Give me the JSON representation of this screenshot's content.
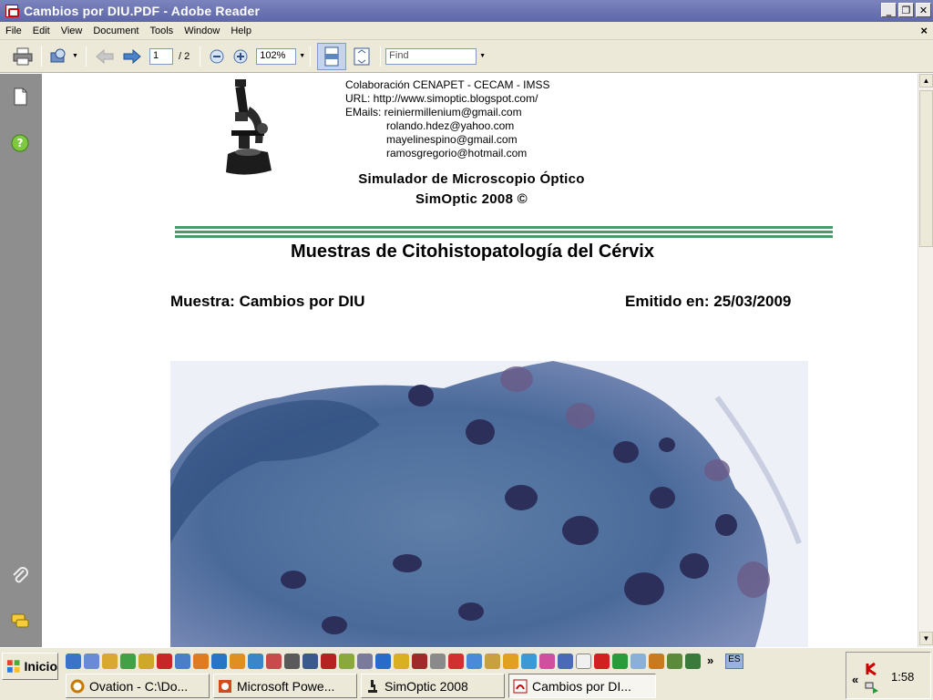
{
  "window": {
    "title": "Cambios por DIU.PDF - Adobe Reader",
    "buttons": [
      "_",
      "❐",
      "✕"
    ]
  },
  "menu": {
    "items": [
      "File",
      "Edit",
      "View",
      "Document",
      "Tools",
      "Window",
      "Help"
    ],
    "close": "×"
  },
  "toolbar": {
    "page_current": "1",
    "page_total": "/ 2",
    "zoom": "102%",
    "find_placeholder": "Find"
  },
  "document": {
    "header_lines": [
      "Colaboración CENAPET - CECAM - IMSS",
      "URL: http://www.simoptic.blogspot.com/",
      "EMails: reiniermillenium@gmail.com",
      "rolando.hdez@yahoo.com",
      "mayelinespino@gmail.com",
      "ramosgregorio@hotmail.com"
    ],
    "simulator_title": "Simulador de Microscopio Óptico",
    "simulator_version": "SimOptic 2008 ©",
    "title": "Muestras de Citohistopatología del Cérvix",
    "sample_label": "Muestra: Cambios por DIU",
    "issued_label": "Emitido en: 25/03/2009"
  },
  "taskbar": {
    "start": "Inicio",
    "tasks": [
      {
        "label": "Ovation - C:\\Do...",
        "icon": "ovation-icon"
      },
      {
        "label": "Microsoft Powe...",
        "icon": "powerpoint-icon"
      },
      {
        "label": "SimOptic 2008",
        "icon": "microscope-icon"
      },
      {
        "label": "Cambios por DI...",
        "icon": "adobe-reader-icon"
      }
    ],
    "language": "ES",
    "clock": "1:58",
    "chevron": "»",
    "tray_chevron": "«"
  },
  "colors": {
    "titlebar": "#6a72b0",
    "nav_panel": "#8e8e8e",
    "accent_rule": "#4a9a6a"
  }
}
